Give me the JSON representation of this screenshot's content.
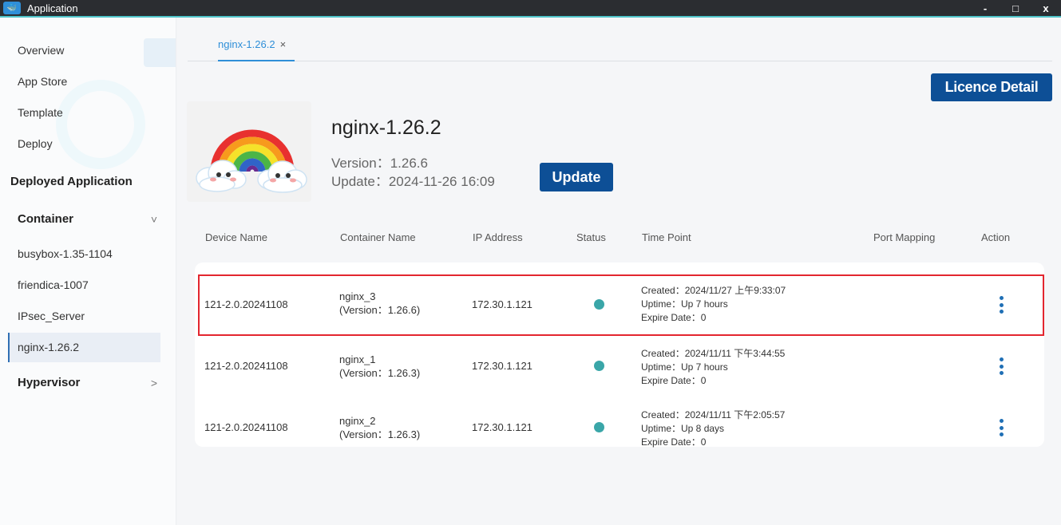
{
  "window": {
    "title": "Application",
    "controls": [
      "-",
      "□",
      "x"
    ]
  },
  "sidebar": {
    "items": [
      {
        "label": "Overview"
      },
      {
        "label": "App Store"
      },
      {
        "label": "Template"
      },
      {
        "label": "Deploy"
      }
    ],
    "section_title": "Deployed Application",
    "container_group": {
      "label": "Container",
      "chevron": "˅",
      "children": [
        {
          "label": "busybox-1.35-1104"
        },
        {
          "label": "friendica-1007"
        },
        {
          "label": "IPsec_Server"
        },
        {
          "label": "nginx-1.26.2",
          "active": true
        }
      ]
    },
    "hypervisor_group": {
      "label": "Hypervisor",
      "chevron": ">"
    }
  },
  "main": {
    "tab": {
      "label": "nginx-1.26.2",
      "close": "×"
    },
    "licence_button": "Licence Detail",
    "app": {
      "name": "nginx-1.26.2",
      "version": "Version：1.26.6",
      "update_time": "Update：2024-11-26 16:09",
      "update_button": "Update",
      "logo_icon": "rainbow-clouds-logo"
    },
    "table": {
      "headers": {
        "device": "Device Name",
        "container": "Container Name",
        "ip": "IP Address",
        "status": "Status",
        "time": "Time Point",
        "port": "Port Mapping",
        "action": "Action"
      },
      "rows": [
        {
          "device": "121-2.0.20241108",
          "container_name": "nginx_3",
          "container_version": "(Version：1.26.6)",
          "ip": "172.30.1.121",
          "status_color": "#3aa6a8",
          "created": "Created：2024/11/27 上午9:33:07",
          "uptime": "Uptime：Up 7 hours",
          "expire": "Expire Date：0",
          "highlighted": true
        },
        {
          "device": "121-2.0.20241108",
          "container_name": "nginx_1",
          "container_version": "(Version：1.26.3)",
          "ip": "172.30.1.121",
          "status_color": "#3aa6a8",
          "created": "Created：2024/11/11 下午3:44:55",
          "uptime": "Uptime：Up 7 hours",
          "expire": "Expire Date：0",
          "highlighted": false
        },
        {
          "device": "121-2.0.20241108",
          "container_name": "nginx_2",
          "container_version": "(Version：1.26.3)",
          "ip": "172.30.1.121",
          "status_color": "#3aa6a8",
          "created": "Created：2024/11/11 下午2:05:57",
          "uptime": "Uptime：Up 8 days",
          "expire": "Expire Date：0",
          "highlighted": false
        }
      ]
    }
  },
  "colors": {
    "accent": "#0d4f96",
    "tab_active": "#2f8fd8",
    "highlight_border": "#e3262f",
    "status_running": "#3aa6a8",
    "titlebar": "#2b2d31"
  }
}
